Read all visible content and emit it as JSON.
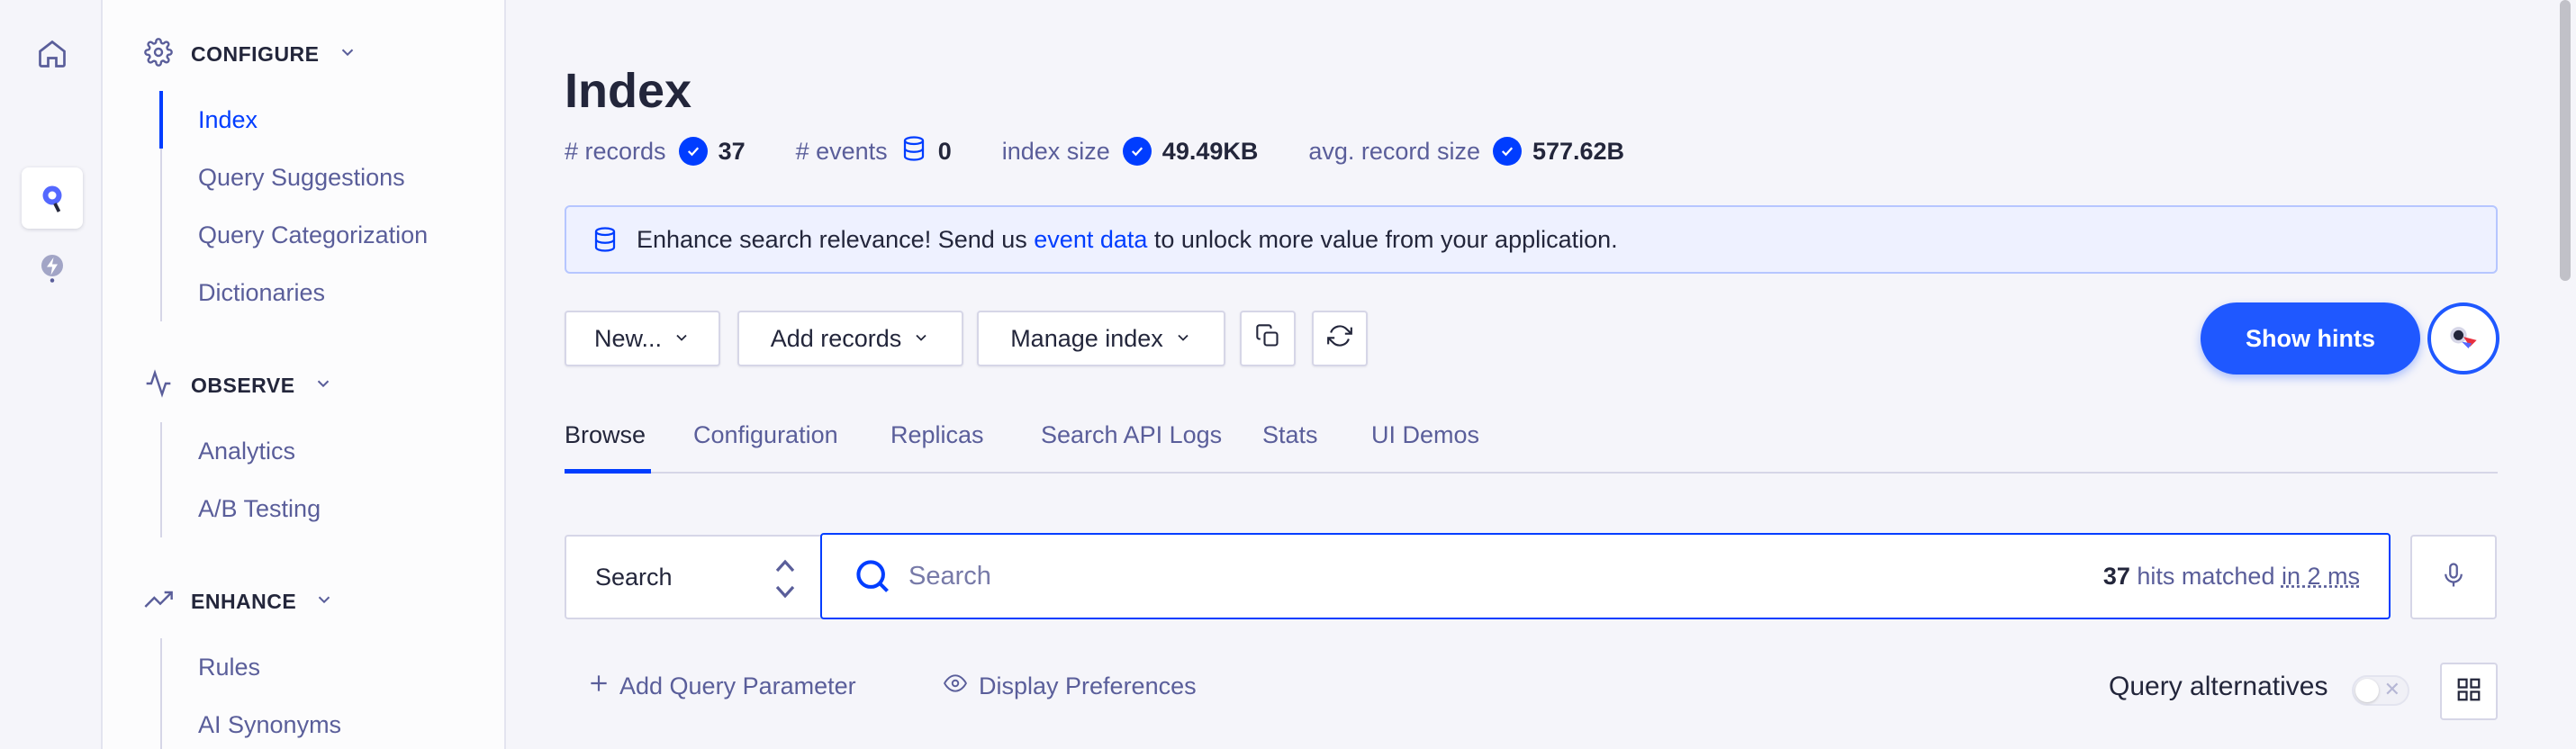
{
  "sidebar": {
    "sections": [
      {
        "title": "CONFIGURE",
        "icon": "gear-icon",
        "items": [
          "Index",
          "Query Suggestions",
          "Query Categorization",
          "Dictionaries"
        ]
      },
      {
        "title": "OBSERVE",
        "icon": "activity-icon",
        "items": [
          "Analytics",
          "A/B Testing"
        ]
      },
      {
        "title": "ENHANCE",
        "icon": "trending-up-icon",
        "items": [
          "Rules",
          "AI Synonyms"
        ]
      }
    ]
  },
  "page": {
    "title": "Index",
    "meta": {
      "records_label": "# records",
      "records_value": "37",
      "events_label": "# events",
      "events_value": "0",
      "index_size_label": "index size",
      "index_size_value": "49.49KB",
      "avg_label": "avg. record size",
      "avg_value": "577.62B"
    }
  },
  "banner": {
    "text_before": "Enhance search relevance! Send us ",
    "link": "event data",
    "text_after": " to unlock more value from your application."
  },
  "toolbar": {
    "new_label": "New...",
    "add_records_label": "Add records",
    "manage_index_label": "Manage index",
    "show_hints_label": "Show hints"
  },
  "tabs": [
    "Browse",
    "Configuration",
    "Replicas",
    "Search API Logs",
    "Stats",
    "UI Demos"
  ],
  "search": {
    "mode": "Search",
    "placeholder": "Search",
    "hits_count": "37",
    "hits_text": " hits matched ",
    "hits_time": "in 2 ms"
  },
  "actions": {
    "add_param": "Add Query Parameter",
    "display_prefs": "Display Preferences",
    "query_alternatives": "Query alternatives"
  },
  "colors": {
    "accent": "#003dff",
    "hints": "#1f58ff"
  }
}
